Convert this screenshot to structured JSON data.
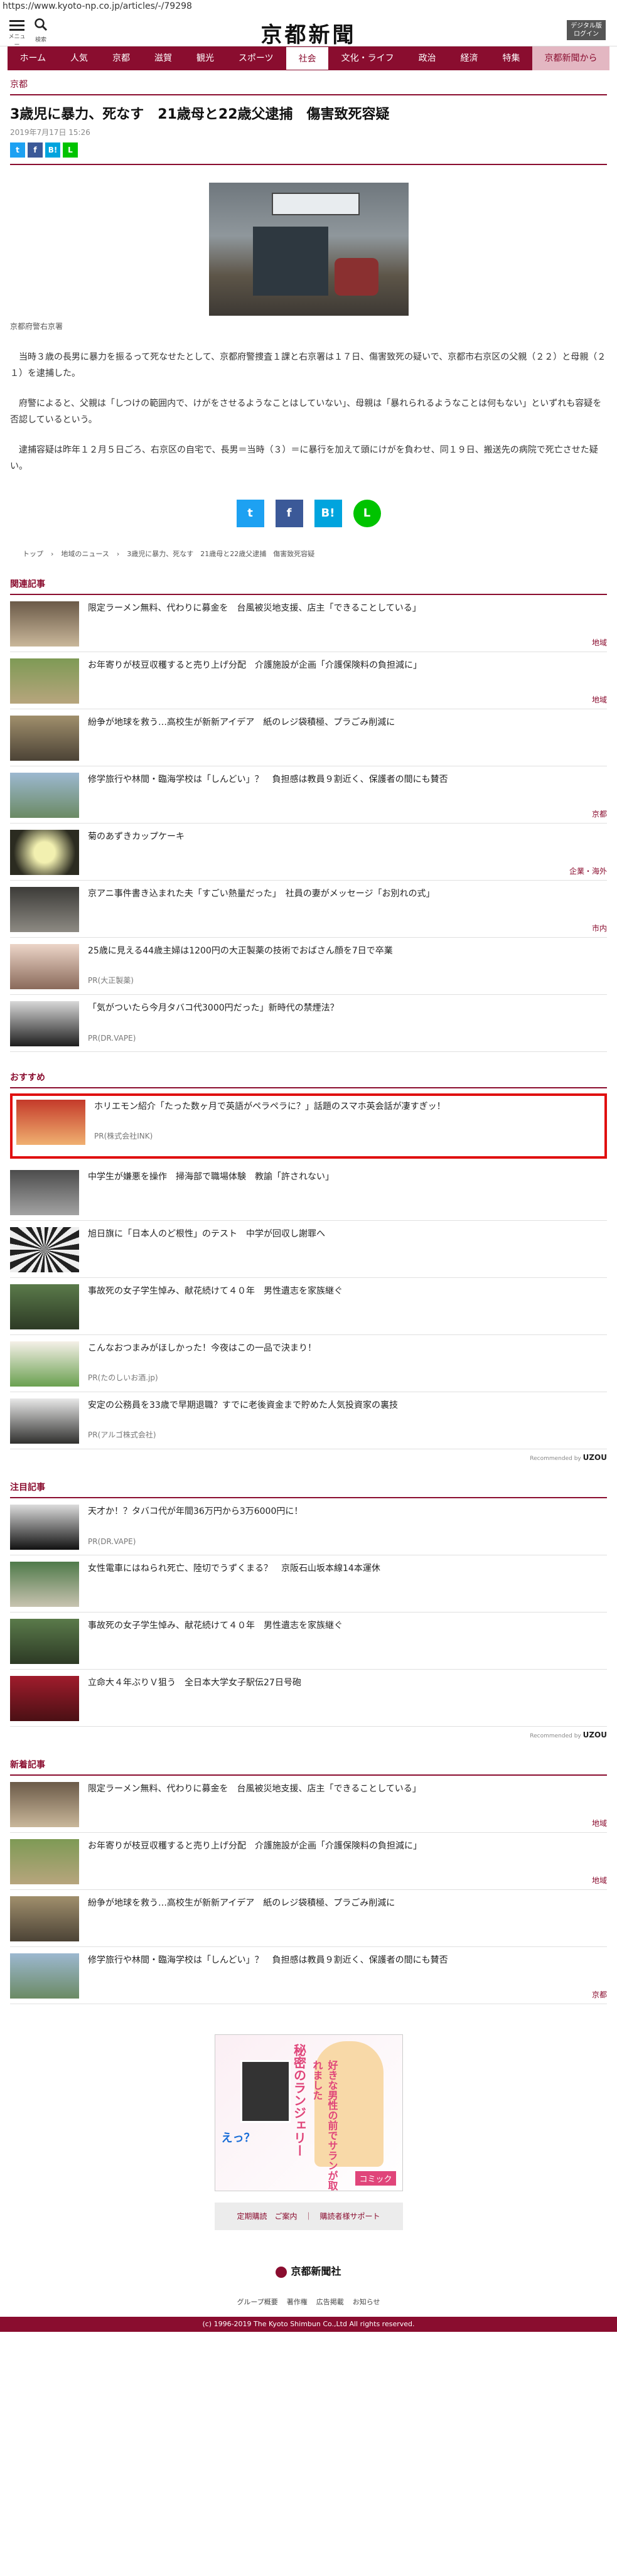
{
  "url": "https://www.kyoto-np.co.jp/articles/-/79298",
  "header": {
    "menu_label": "メニュー",
    "search_label": "検索",
    "logo": "京都新聞",
    "login": "デジタル版\nログイン"
  },
  "nav": [
    "ホーム",
    "人気",
    "京都",
    "滋賀",
    "観光",
    "スポーツ",
    "社会",
    "文化・ライフ",
    "政治",
    "経済",
    "特集",
    "京都新聞から"
  ],
  "article": {
    "category": "京都",
    "title": "3歳児に暴力、死なす　21歳母と22歳父逮捕　傷害致死容疑",
    "date": "2019年7月17日 15:26",
    "photo_caption": "京都府警右京署",
    "paragraphs": [
      "　当時３歳の長男に暴力を振るって死なせたとして、京都府警捜査１課と右京署は１７日、傷害致死の疑いで、京都市右京区の父親（２２）と母親（２１）を逮捕した。",
      "　府警によると、父親は「しつけの範囲内で、けがをさせるようなことはしていない」、母親は「暴れられるようなことは何もない」といずれも容疑を否認しているという。",
      "　逮捕容疑は昨年１２月５日ごろ、右京区の自宅で、長男＝当時（３）＝に暴行を加えて頭にけがを負わせ、同１９日、搬送先の病院で死亡させた疑い。"
    ],
    "breadcrumb": [
      "トップ",
      "地域のニュース",
      "3歳児に暴力、死なす　21歳母と22歳父逮捕　傷害致死容疑"
    ]
  },
  "share": {
    "twitter": "t",
    "facebook": "f",
    "hatena": "B!",
    "line": "L"
  },
  "related": {
    "title": "関連記事",
    "items": [
      {
        "title": "限定ラーメン無料、代わりに募金を　台風被災地支援、店主「できることしている」",
        "tag": "地域"
      },
      {
        "title": "お年寄りが枝豆収穫すると売り上げ分配　介護施設が企画「介護保険料の負担減に」",
        "tag": "地域"
      },
      {
        "title": "紛争が地球を救う…高校生が新新アイデア　紙のレジ袋積極、プラごみ削減に",
        "tag": ""
      },
      {
        "title": "修学旅行や林間・臨海学校は「しんどい」？　負担感は教員９割近く、保護者の間にも賛否",
        "tag": "京都"
      },
      {
        "title": "菊のあずきカップケーキ",
        "tag": "企業・海外"
      },
      {
        "title": "京アニ事件書き込まれた夫「すごい熱量だった」　社員の妻がメッセージ「お別れの式」",
        "tag": "市内"
      },
      {
        "title": "25歳に見える44歳主婦は1200円の大正製薬の技術でおばさん顔を7日で卒業",
        "pr": "PR(大正製薬)"
      },
      {
        "title": "「気がついたら今月タバコ代3000円だった」新時代の禁煙法？",
        "pr": "PR(DR.VAPE)"
      }
    ]
  },
  "recommend": {
    "title": "おすすめ",
    "recby": "Recommended by",
    "brand": "UZOU",
    "items": [
      {
        "title": "ホリエモン紹介「たった数ヶ月で英語がペラペラに？」話題のスマホ英会話が凄すぎッ！",
        "pr": "PR(株式会社INK)"
      },
      {
        "title": "中学生が嫌悪を操作　掃海部で職場体験　教諭「許されない」"
      },
      {
        "title": "旭日旗に「日本人のど根性」のテスト　中学が回収し謝罪へ"
      },
      {
        "title": "事故死の女子学生悼み、献花続けて４０年　男性遺志を家族継ぐ"
      },
      {
        "title": "こんなおつまみがほしかった！今夜はこの一品で決まり！",
        "pr": "PR(たのしいお酒.jp)"
      },
      {
        "title": "安定の公務員を33歳で早期退職？すでに老後資金まで貯めた人気投資家の裏技",
        "pr": "PR(アルゴ株式会社)"
      }
    ]
  },
  "attention": {
    "title": "注目記事",
    "recby": "Recommended by",
    "brand": "UZOU",
    "items": [
      {
        "title": "天才か！？タバコ代が年間36万円から3万6000円に！",
        "pr": "PR(DR.VAPE)"
      },
      {
        "title": "女性電車にはねられ死亡、陸切でうずくまる？　京阪石山坂本線14本運休"
      },
      {
        "title": "事故死の女子学生悼み、献花続けて４０年　男性遺志を家族継ぐ"
      },
      {
        "title": "立命大４年ぶりＶ狙う　全日本大学女子駅伝27日号砲"
      }
    ]
  },
  "latest": {
    "title": "新着記事",
    "items": [
      {
        "title": "限定ラーメン無料、代わりに募金を　台風被災地支援、店主「できることしている」",
        "tag": "地域"
      },
      {
        "title": "お年寄りが枝豆収穫すると売り上げ分配　介護施設が企画「介護保険料の負担減に」",
        "tag": "地域"
      },
      {
        "title": "紛争が地球を救う…高校生が新新アイデア　紙のレジ袋積極、プラごみ削減に",
        "tag": ""
      },
      {
        "title": "修学旅行や林間・臨海学校は「しんどい」？　負担感は教員９割近く、保護者の間にも賛否",
        "tag": "京都"
      }
    ]
  },
  "ad": {
    "line1": "秘密のランジェリー",
    "line2": "好きな男性の前でサランが取れました",
    "line3": "えっ？",
    "badge": "コミック"
  },
  "footer": {
    "subscribe": "定期購読　ご案内　｜　購読者様サポート",
    "logo": "京都新聞社",
    "links": [
      "グループ概要",
      "著作権",
      "広告掲載",
      "お知らせ"
    ],
    "copyright": "(c) 1996-2019 The Kyoto Shimbun Co.,Ltd All rights reserved."
  }
}
